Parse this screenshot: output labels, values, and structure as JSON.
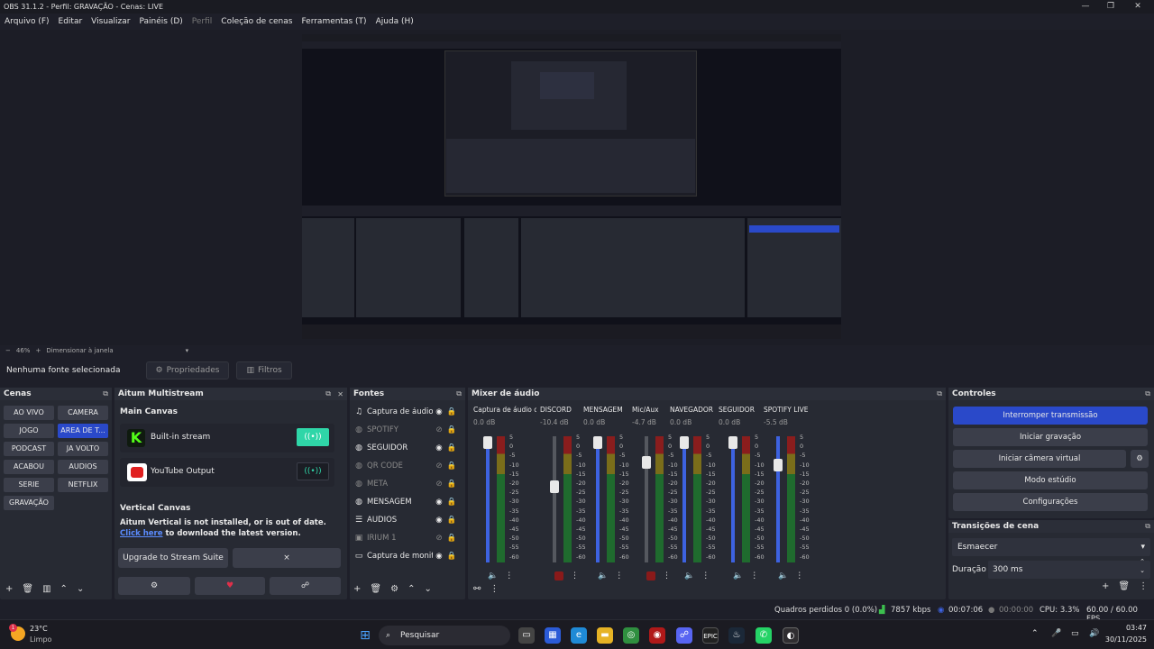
{
  "window": {
    "title": "OBS 31.1.2 - Perfil: GRAVAÇÃO - Cenas: LIVE",
    "min": "—",
    "max": "❐",
    "close": "✕"
  },
  "menu": [
    {
      "label": "Arquivo (F)",
      "disabled": false
    },
    {
      "label": "Editar",
      "disabled": false
    },
    {
      "label": "Visualizar",
      "disabled": false
    },
    {
      "label": "Painéis (D)",
      "disabled": false
    },
    {
      "label": "Perfil",
      "disabled": true
    },
    {
      "label": "Coleção de cenas",
      "disabled": false
    },
    {
      "label": "Ferramentas (T)",
      "disabled": false
    },
    {
      "label": "Ajuda (H)",
      "disabled": false
    }
  ],
  "preview_toolbar": {
    "zoom_minus": "−",
    "zoom": "46%",
    "zoom_plus": "+",
    "fit": "Dimensionar à janela",
    "dropdown": "▾"
  },
  "context": {
    "no_source": "Nenhuma fonte selecionada",
    "properties": "Propriedades",
    "filters": "Filtros"
  },
  "scenes": {
    "title": "Cenas",
    "items": [
      {
        "label": "AO VIVO",
        "selected": false
      },
      {
        "label": "CAMERA",
        "selected": false
      },
      {
        "label": "JOGO",
        "selected": false
      },
      {
        "label": "AREA DE T...",
        "selected": true
      },
      {
        "label": "PODCAST",
        "selected": false
      },
      {
        "label": "JA VOLTO",
        "selected": false
      },
      {
        "label": "ACABOU",
        "selected": false
      },
      {
        "label": "AUDIOS",
        "selected": false
      },
      {
        "label": "SERIE",
        "selected": false
      },
      {
        "label": "NETFLIX",
        "selected": false
      },
      {
        "label": "GRAVAÇÃO",
        "selected": false
      }
    ]
  },
  "multistream": {
    "title": "Aitum Multistream",
    "main_canvas": "Main Canvas",
    "builtin": "Built-in stream",
    "youtube": "YouTube Output",
    "vertical_canvas": "Vertical Canvas",
    "vertical_msg": "Aitum Vertical is not installed, or is out of date.",
    "click_here": "Click here",
    "download_msg": " to download the latest version.",
    "upgrade": "Upgrade to Stream Suite",
    "dismiss": "×"
  },
  "sources": {
    "title": "Fontes",
    "items": [
      {
        "label": "Captura de áudio",
        "icon": "audio-capture-icon",
        "glyph": "♫",
        "visible": true,
        "dim": false
      },
      {
        "label": "SPOTIFY",
        "icon": "browser-icon",
        "glyph": "◍",
        "visible": false,
        "dim": true
      },
      {
        "label": "SEGUIDOR",
        "icon": "browser-icon",
        "glyph": "◍",
        "visible": true,
        "dim": false
      },
      {
        "label": "QR CODE",
        "icon": "browser-icon",
        "glyph": "◍",
        "visible": false,
        "dim": true
      },
      {
        "label": "META",
        "icon": "browser-icon",
        "glyph": "◍",
        "visible": false,
        "dim": true
      },
      {
        "label": "MENSAGEM",
        "icon": "browser-icon",
        "glyph": "◍",
        "visible": true,
        "dim": false
      },
      {
        "label": "AUDIOS",
        "icon": "group-icon",
        "glyph": "☰",
        "visible": true,
        "dim": false
      },
      {
        "label": "IRIUM 1",
        "icon": "video-capture-icon",
        "glyph": "▣",
        "visible": false,
        "dim": true
      },
      {
        "label": "Captura de monitor",
        "icon": "monitor-icon",
        "glyph": "▭",
        "visible": true,
        "dim": false
      }
    ]
  },
  "mixer": {
    "title": "Mixer de áudio",
    "scale": [
      "5",
      "0",
      "-5",
      "-10",
      "-15",
      "-20",
      "-25",
      "-30",
      "-35",
      "-40",
      "-45",
      "-50",
      "-55",
      "-60"
    ],
    "channels": [
      {
        "name": "Captura de áudio c",
        "db": "0.0 dB",
        "level": 1.0,
        "muted": false,
        "active": true
      },
      {
        "name": "DISCORD",
        "db": "-10.4 dB",
        "level": 0.59,
        "muted": true,
        "active": false
      },
      {
        "name": "MENSAGEM",
        "db": "0.0 dB",
        "level": 1.0,
        "muted": false,
        "active": true
      },
      {
        "name": "Mic/Aux",
        "db": "-4.7 dB",
        "level": 0.82,
        "muted": true,
        "active": false
      },
      {
        "name": "NAVEGADOR",
        "db": "0.0 dB",
        "level": 1.0,
        "muted": false,
        "active": true
      },
      {
        "name": "SEGUIDOR",
        "db": "0.0 dB",
        "level": 1.0,
        "muted": false,
        "active": true
      },
      {
        "name": "SPOTIFY LIVE",
        "db": "-5.5 dB",
        "level": 0.79,
        "muted": false,
        "active": true
      }
    ]
  },
  "controls": {
    "title": "Controles",
    "stop_stream": "Interromper transmissão",
    "start_record": "Iniciar gravação",
    "virtual_cam": "Iniciar câmera virtual",
    "studio": "Modo estúdio",
    "settings": "Configurações"
  },
  "transitions": {
    "title": "Transições de cena",
    "selected": "Esmaecer",
    "duration_label": "Duração",
    "duration": "300 ms"
  },
  "status": {
    "dropped": "Quadros perdidos 0 (0.0%)",
    "bitrate": "7857 kbps",
    "live_time": "00:07:06",
    "rec_time": "00:00:00",
    "cpu": "CPU: 3.3%",
    "fps": "60.00 / 60.00 FPS"
  },
  "taskbar": {
    "temp": "23°C",
    "weather": "Limpo",
    "search": "Pesquisar",
    "time": "03:47",
    "date": "30/11/2025",
    "weather_badge": "1"
  },
  "colors": {
    "accent": "#2a49c9",
    "panel": "#272a33",
    "bg": "#1e1f29",
    "meter_green": "#1f6b2e",
    "meter_red": "#8a1d1d"
  }
}
